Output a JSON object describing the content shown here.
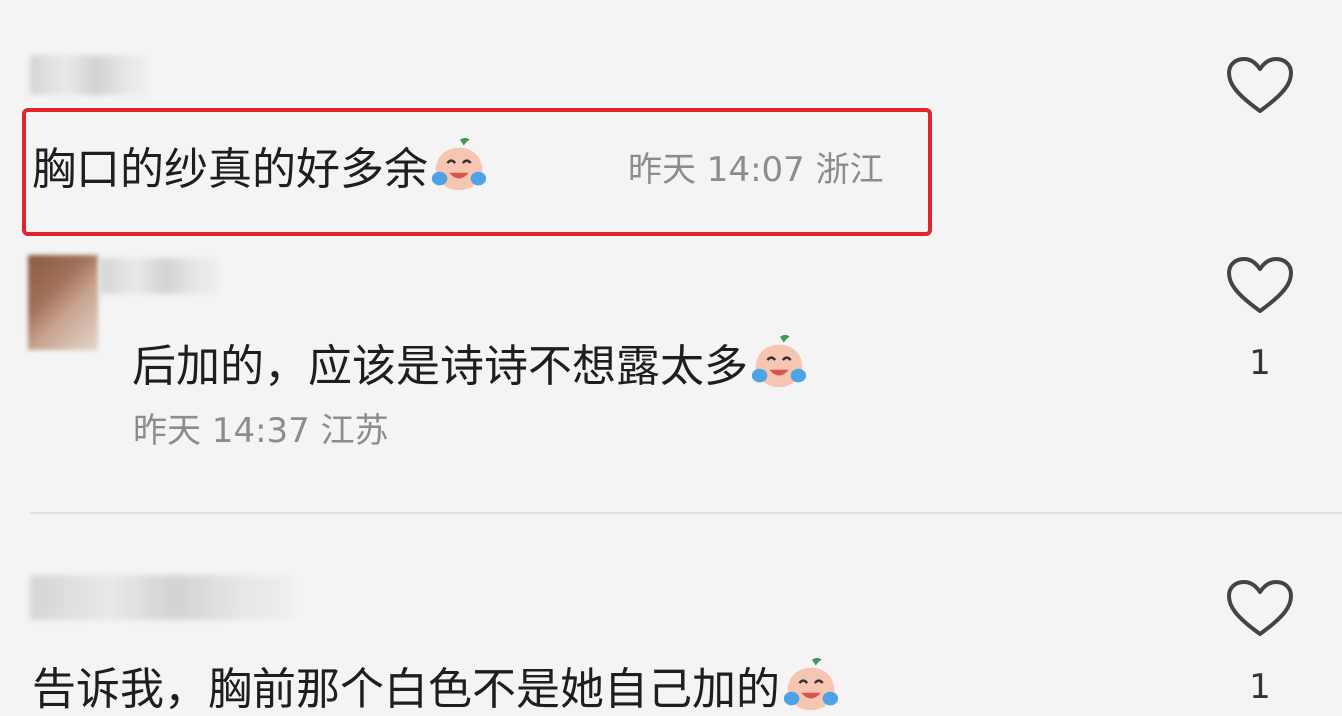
{
  "comments": [
    {
      "text": "胸口的纱真的好多余",
      "emoji": "crying-laughing-face-icon",
      "time": "昨天 14:07",
      "location": "浙江",
      "likes": ""
    },
    {
      "text": "后加的，应该是诗诗不想露太多",
      "emoji": "crying-laughing-face-icon",
      "time": "昨天 14:37",
      "location": "江苏",
      "likes": "1"
    },
    {
      "text": "告诉我，胸前那个白色不是她自己加的",
      "emoji": "crying-laughing-face-icon",
      "time": "",
      "location": "",
      "likes": "1"
    }
  ],
  "colors": {
    "highlight": "#e0262b",
    "meta_text": "#8c8c8c"
  }
}
